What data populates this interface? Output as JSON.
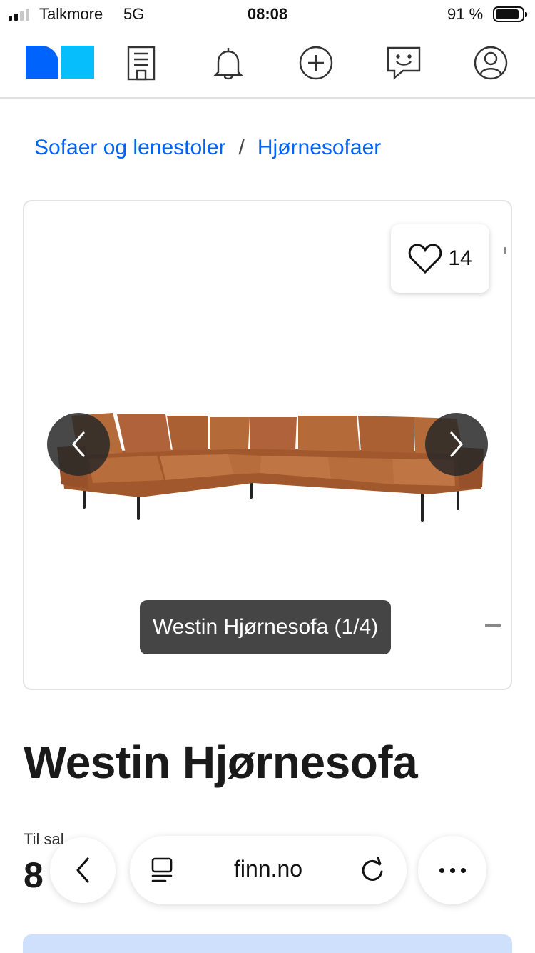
{
  "status_bar": {
    "carrier": "Talkmore",
    "network": "5G",
    "time": "08:08",
    "battery": "91 %",
    "battery_level": 0.91,
    "signal_bars": 2
  },
  "nav": {
    "logo": "finn-logo",
    "icons": [
      "company-icon",
      "bell-icon",
      "plus-circle-icon",
      "message-icon",
      "profile-icon"
    ],
    "colors": {
      "logo_dark": "#0063fb",
      "logo_light": "#06befb"
    }
  },
  "breadcrumb": {
    "items": [
      "Sofaer og lenestoler",
      "Hjørnesofaer"
    ],
    "separator": "/"
  },
  "gallery": {
    "favorite_count": "14",
    "caption": "Westin Hjørnesofa (1/4)",
    "image": "corner-sofa-photo"
  },
  "listing": {
    "title": "Westin Hjørnesofa",
    "sale_label": "Til sal",
    "price_partial": "8"
  },
  "browser": {
    "url": "finn.no"
  }
}
